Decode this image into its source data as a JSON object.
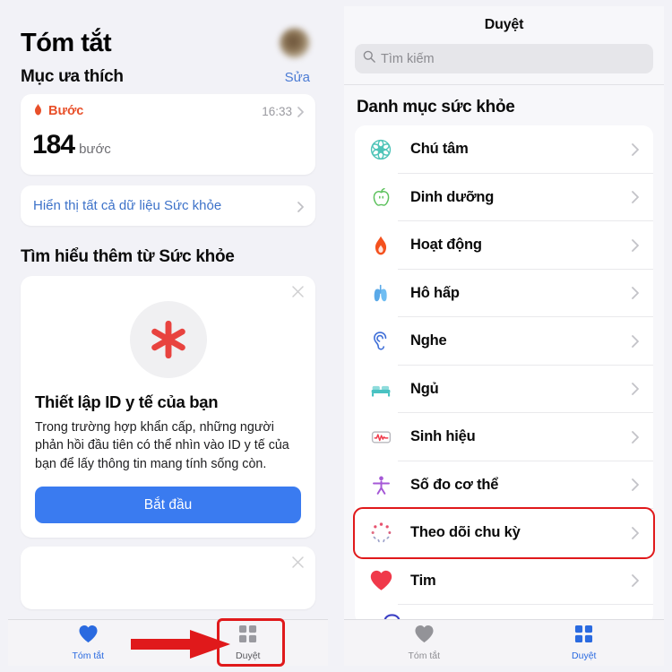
{
  "left_screen": {
    "page_title": "Tóm tắt",
    "avatar": "user-avatar",
    "favorites": {
      "heading": "Mục ưa thích",
      "edit_label": "Sửa"
    },
    "step_card": {
      "icon": "flame-icon",
      "label": "Bước",
      "time": "16:33",
      "value": "184",
      "unit": "bước",
      "chevron": "chevron-right-icon"
    },
    "show_all_link": {
      "label": "Hiển thị tất cả dữ liệu Sức khỏe",
      "chevron": "chevron-right-icon"
    },
    "learn_more_heading": "Tìm hiểu thêm từ Sức khỏe",
    "medical_id_card": {
      "close_icon": "close-icon",
      "icon": "medical-asterisk-icon",
      "title": "Thiết lập ID y tế của bạn",
      "body": "Trong trường hợp khẩn cấp, những người phản hồi đầu tiên có thể nhìn vào ID y tế của bạn để lấy thông tin mang tính sống còn.",
      "button_label": "Bắt đầu"
    },
    "second_card": {
      "close_icon": "close-icon"
    },
    "tabbar": [
      {
        "icon": "heart-icon",
        "label": "Tóm tắt",
        "state": "active"
      },
      {
        "icon": "grid-squares-icon",
        "label": "Duyệt",
        "state": "inactive"
      }
    ]
  },
  "right_screen": {
    "nav_title": "Duyệt",
    "search": {
      "icon": "search-icon",
      "placeholder": "Tìm kiếm"
    },
    "section_title": "Danh mục sức khỏe",
    "categories": [
      {
        "icon": "mindfulness-mandala-icon",
        "label": "Chú tâm",
        "color": "#4ec4b8",
        "chevron": "chevron-right-icon",
        "highlighted": false
      },
      {
        "icon": "apple-nutrition-icon",
        "label": "Dinh dưỡng",
        "color": "#5cc15c",
        "chevron": "chevron-right-icon",
        "highlighted": false
      },
      {
        "icon": "flame-activity-icon",
        "label": "Hoạt động",
        "color": "#f4511e",
        "chevron": "chevron-right-icon",
        "highlighted": false
      },
      {
        "icon": "lungs-icon",
        "label": "Hô hấp",
        "color": "#5aa9e8",
        "chevron": "chevron-right-icon",
        "highlighted": false
      },
      {
        "icon": "ear-hearing-icon",
        "label": "Nghe",
        "color": "#3f6fd8",
        "chevron": "chevron-right-icon",
        "highlighted": false
      },
      {
        "icon": "bed-sleep-icon",
        "label": "Ngủ",
        "color": "#49c2c2",
        "chevron": "chevron-right-icon",
        "highlighted": false
      },
      {
        "icon": "vitals-waveform-icon",
        "label": "Sinh hiệu",
        "color": "#f0394a",
        "chevron": "chevron-right-icon",
        "highlighted": false
      },
      {
        "icon": "body-measure-icon",
        "label": "Số đo cơ thể",
        "color": "#a558d6",
        "chevron": "chevron-right-icon",
        "highlighted": false
      },
      {
        "icon": "cycle-tracking-icon",
        "label": "Theo dõi chu kỳ",
        "color": "#e7526e",
        "chevron": "chevron-right-icon",
        "highlighted": true
      },
      {
        "icon": "heart-icon",
        "label": "Tim",
        "color": "#f0394a",
        "chevron": "chevron-right-icon",
        "highlighted": false
      }
    ],
    "partial_row": {
      "icon": "symptoms-icon",
      "color": "#3b3fc4"
    },
    "tabbar": [
      {
        "icon": "heart-icon",
        "label": "Tóm tắt",
        "state": "inactive"
      },
      {
        "icon": "grid-squares-icon",
        "label": "Duyệt",
        "state": "active"
      }
    ]
  },
  "annotations": {
    "arrow": {
      "name": "red-arrow-annotation",
      "color": "#e0191b"
    },
    "tab_box": {
      "name": "red-highlight-box-duyet-tab",
      "color": "#e0191b"
    },
    "row_box": {
      "name": "red-highlight-box-cycle-tracking",
      "color": "#e0191b"
    }
  }
}
